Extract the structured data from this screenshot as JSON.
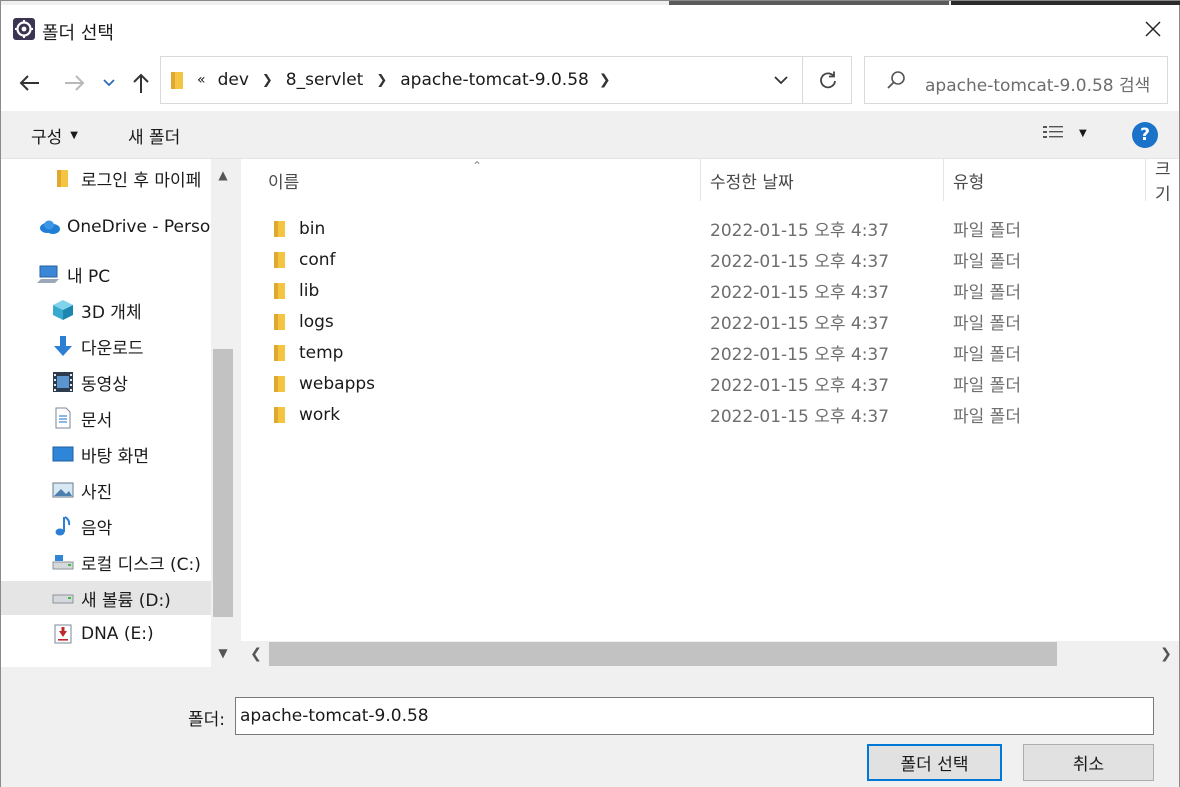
{
  "window": {
    "title": "폴더 선택"
  },
  "address": {
    "overflow": "«",
    "crumbs": [
      "dev",
      "8_servlet",
      "apache-tomcat-9.0.58"
    ]
  },
  "search": {
    "placeholder": "apache-tomcat-9.0.58 검색"
  },
  "toolbar": {
    "organize_label": "구성",
    "new_folder_label": "새 폴더"
  },
  "nav": {
    "items": [
      {
        "label": "로그인 후 마이페",
        "icon": "folder-icon"
      },
      {
        "label": "OneDrive - Persor",
        "icon": "onedrive-icon"
      },
      {
        "label": "내 PC",
        "icon": "pc-icon"
      },
      {
        "label": "3D 개체",
        "icon": "3d-objects-icon"
      },
      {
        "label": "다운로드",
        "icon": "download-icon"
      },
      {
        "label": "동영상",
        "icon": "video-icon"
      },
      {
        "label": "문서",
        "icon": "document-icon"
      },
      {
        "label": "바탕 화면",
        "icon": "desktop-icon"
      },
      {
        "label": "사진",
        "icon": "pictures-icon"
      },
      {
        "label": "음악",
        "icon": "music-icon"
      },
      {
        "label": "로컬 디스크 (C:)",
        "icon": "drive-c-icon"
      },
      {
        "label": "새 볼륨 (D:)",
        "icon": "drive-d-icon",
        "selected": true
      },
      {
        "label": "DNA (E:)",
        "icon": "usb-drive-icon"
      }
    ]
  },
  "columns": {
    "name": "이름",
    "modified": "수정한 날짜",
    "type": "유형",
    "size": "크기"
  },
  "files": [
    {
      "name": "bin",
      "modified": "2022-01-15 오후 4:37",
      "type": "파일 폴더"
    },
    {
      "name": "conf",
      "modified": "2022-01-15 오후 4:37",
      "type": "파일 폴더"
    },
    {
      "name": "lib",
      "modified": "2022-01-15 오후 4:37",
      "type": "파일 폴더"
    },
    {
      "name": "logs",
      "modified": "2022-01-15 오후 4:37",
      "type": "파일 폴더"
    },
    {
      "name": "temp",
      "modified": "2022-01-15 오후 4:37",
      "type": "파일 폴더"
    },
    {
      "name": "webapps",
      "modified": "2022-01-15 오후 4:37",
      "type": "파일 폴더"
    },
    {
      "name": "work",
      "modified": "2022-01-15 오후 4:37",
      "type": "파일 폴더"
    }
  ],
  "footer": {
    "folder_label": "폴더:",
    "folder_value": "apache-tomcat-9.0.58",
    "select_label": "폴더 선택",
    "cancel_label": "취소"
  },
  "colors": {
    "accent": "#0078d7",
    "folder": "#f4c542",
    "help": "#1a73c8"
  }
}
